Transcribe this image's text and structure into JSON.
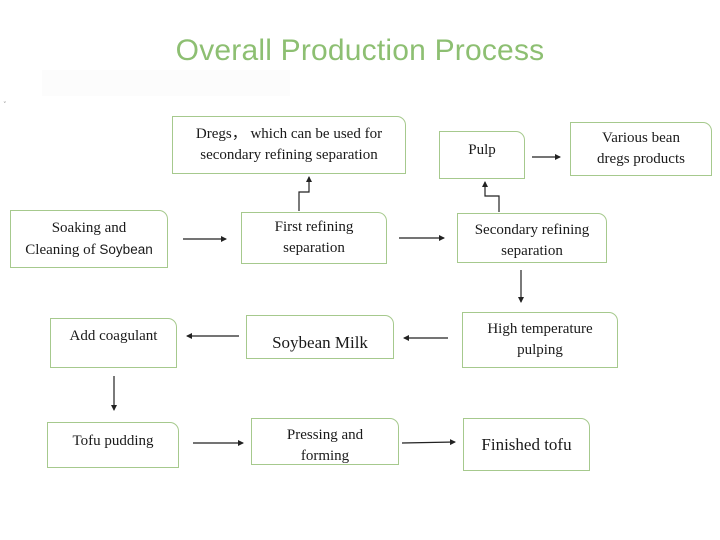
{
  "title": "Overall Production Process",
  "accent_color": "#8dbf72",
  "box_border_color": "#a6c98d",
  "misc_mark": "˅",
  "nodes": {
    "dregs": {
      "line1": "Dregs， which can be used for",
      "line2": "secondary refining separation"
    },
    "pulp": {
      "line1": "Pulp"
    },
    "bean_dregs_products": {
      "line1": "Various bean",
      "line2": "dregs products"
    },
    "soaking": {
      "line1": "Soaking and",
      "line2a": "Cleaning of ",
      "line2b": "Soybean"
    },
    "first_refining": {
      "line1": "First refining",
      "line2": "separation"
    },
    "secondary_refining": {
      "line1": "Secondary refining",
      "line2": "separation"
    },
    "high_temp": {
      "line1": "High temperature",
      "line2": "pulping"
    },
    "soybean_milk": {
      "line1": "Soybean Milk"
    },
    "add_coagulant": {
      "line1": "Add coagulant"
    },
    "tofu_pudding": {
      "line1": "Tofu pudding"
    },
    "pressing": {
      "line1": "Pressing and",
      "line2": "forming"
    },
    "finished_tofu": {
      "line1": "Finished tofu"
    }
  },
  "edges": [
    {
      "from": "soaking",
      "to": "first_refining"
    },
    {
      "from": "first_refining",
      "to": "dregs"
    },
    {
      "from": "first_refining",
      "to": "secondary_refining"
    },
    {
      "from": "secondary_refining",
      "to": "pulp"
    },
    {
      "from": "pulp",
      "to": "bean_dregs_products"
    },
    {
      "from": "secondary_refining",
      "to": "high_temp"
    },
    {
      "from": "high_temp",
      "to": "soybean_milk"
    },
    {
      "from": "soybean_milk",
      "to": "add_coagulant"
    },
    {
      "from": "add_coagulant",
      "to": "tofu_pudding"
    },
    {
      "from": "tofu_pudding",
      "to": "pressing"
    },
    {
      "from": "pressing",
      "to": "finished_tofu"
    }
  ]
}
